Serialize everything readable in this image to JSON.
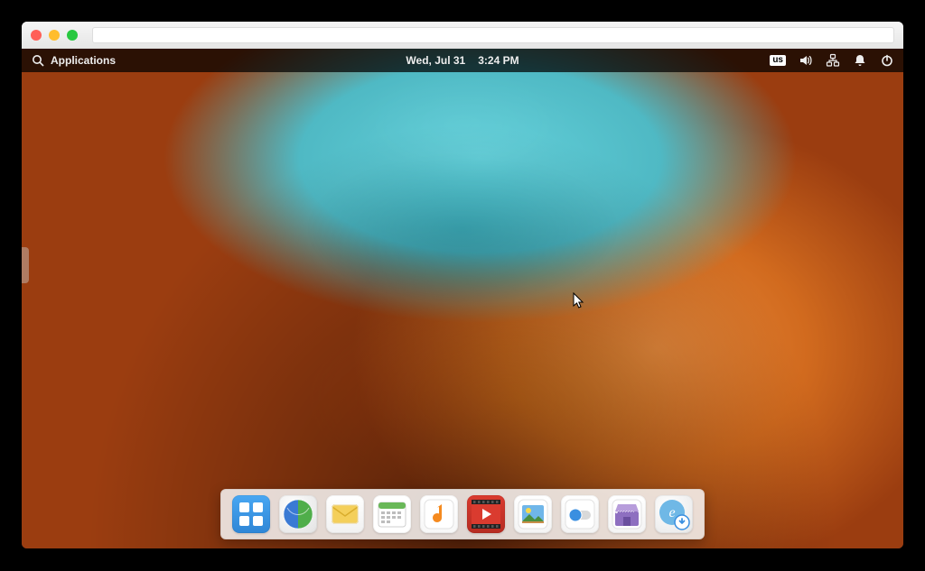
{
  "topbar": {
    "applications_label": "Applications",
    "date": "Wed, Jul 31",
    "time": "3:24 PM",
    "language_indicator": "us"
  },
  "dock": {
    "items": [
      {
        "name": "multitasking-view"
      },
      {
        "name": "web-browser"
      },
      {
        "name": "mail"
      },
      {
        "name": "calendar"
      },
      {
        "name": "music"
      },
      {
        "name": "videos"
      },
      {
        "name": "photos"
      },
      {
        "name": "system-settings"
      },
      {
        "name": "app-center"
      },
      {
        "name": "installer"
      }
    ]
  }
}
